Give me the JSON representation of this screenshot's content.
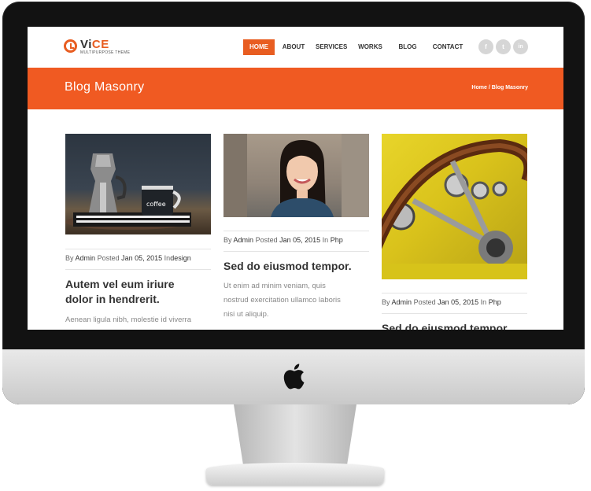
{
  "site": {
    "logo_text_main": "Vi",
    "logo_text_accent": "CE",
    "logo_tagline": "MULTIPURPOSE THEME"
  },
  "nav": {
    "items": [
      {
        "label": "HOME",
        "active": true
      },
      {
        "label": "ABOUT"
      },
      {
        "label": "SERVICES"
      },
      {
        "label": "WORKS"
      },
      {
        "label": "BLOG"
      },
      {
        "label": "CONTACT"
      }
    ]
  },
  "social": [
    {
      "icon": "facebook-icon",
      "glyph": "f"
    },
    {
      "icon": "twitter-icon",
      "glyph": "t"
    },
    {
      "icon": "linkedin-icon",
      "glyph": "in"
    }
  ],
  "banner": {
    "title": "Blog Masonry",
    "breadcrumb": "Home / Blog Masonry"
  },
  "posts": [
    {
      "by_label": "By",
      "author": "Admin",
      "posted_label": "Posted",
      "date": "Jan 05, 2015",
      "in_label": "In",
      "category": "design",
      "title_line1": "Autem vel eum iriure",
      "title_line2": "dolor in hendrerit.",
      "excerpt": "Aenean ligula nibh, molestie id viverra"
    },
    {
      "by_label": "By",
      "author": "Admin",
      "posted_label": "Posted",
      "date": "Jan 05, 2015",
      "in_label": "In",
      "category": "Php",
      "title_line1": "Sed do eiusmod tempor.",
      "excerpt_line1": "Ut enim ad minim veniam, quis",
      "excerpt_line2": "nostrud exercitation ullamco laboris",
      "excerpt_line3": "nisi ut aliquip."
    },
    {
      "by_label": "By",
      "author": "Admin",
      "posted_label": "Posted",
      "date": "Jan 05, 2015",
      "in_label": "In",
      "category": "Php",
      "title_line1": "Sed do eiusmod tempor."
    }
  ],
  "colors": {
    "accent": "#e85d21",
    "banner": "#f05a22"
  }
}
